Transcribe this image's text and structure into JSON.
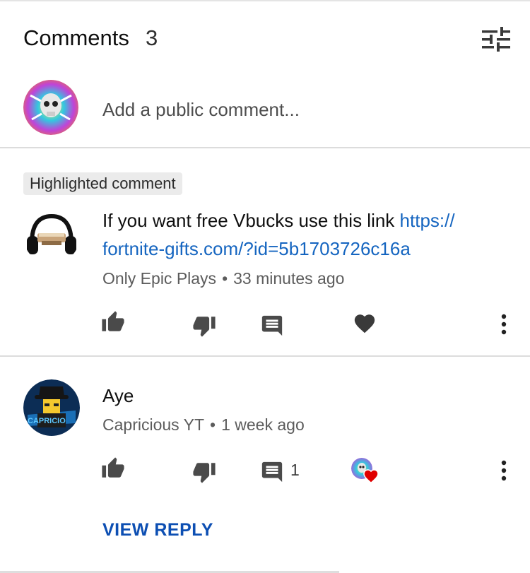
{
  "header": {
    "title": "Comments",
    "count": "3",
    "sort_icon": "sort-filter-icon"
  },
  "add_comment": {
    "placeholder": "Add a public comment..."
  },
  "comments": [
    {
      "badge": "Highlighted comment",
      "text": "If you want free Vbucks use this link ",
      "link": "https://fortnite-gifts.com/?id=5b1703726c16a",
      "link_line1": "https://",
      "link_line2": "fortnite-gifts.com/?id=5b1703726c16a",
      "author": "Only Epic Plays",
      "time": "33 minutes ago",
      "actions": [
        "like-icon",
        "dislike-icon",
        "reply-icon",
        "heart-icon",
        "more-vert-icon"
      ]
    },
    {
      "text": "Aye",
      "author": "Capricious YT",
      "time": "1 week ago",
      "reply_count": "1",
      "actions": [
        "like-icon",
        "dislike-icon",
        "reply-icon",
        "creator-heart-icon",
        "more-vert-icon"
      ],
      "view_reply": "VIEW REPLY"
    }
  ],
  "colors": {
    "link": "#1565c0",
    "view_reply": "#0d4fb3",
    "heart": "#e00000",
    "icon": "#4a4a4a"
  }
}
